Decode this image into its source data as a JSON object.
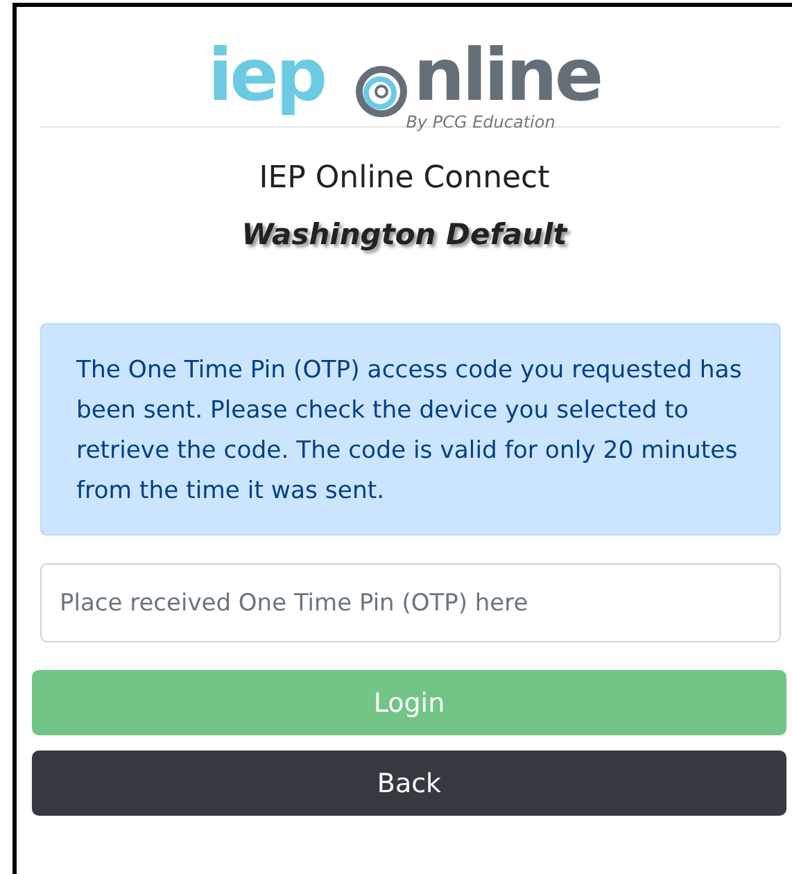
{
  "logo": {
    "first": "iep",
    "second": "nline",
    "tagline": "By PCG Education"
  },
  "title": "IEP Online Connect",
  "subtitle": "Washington Default",
  "alert": "The One Time Pin (OTP) access code you requested has been sent. Please check the device you selected to retrieve the code. The code is valid for only 20 minutes from the time it was sent.",
  "otp_field": {
    "placeholder": "Place received One Time Pin (OTP) here"
  },
  "buttons": [
    {
      "kind": "success",
      "label": "Login",
      "disabled": true
    },
    {
      "kind": "dark",
      "label": "Back",
      "disabled": false
    }
  ]
}
